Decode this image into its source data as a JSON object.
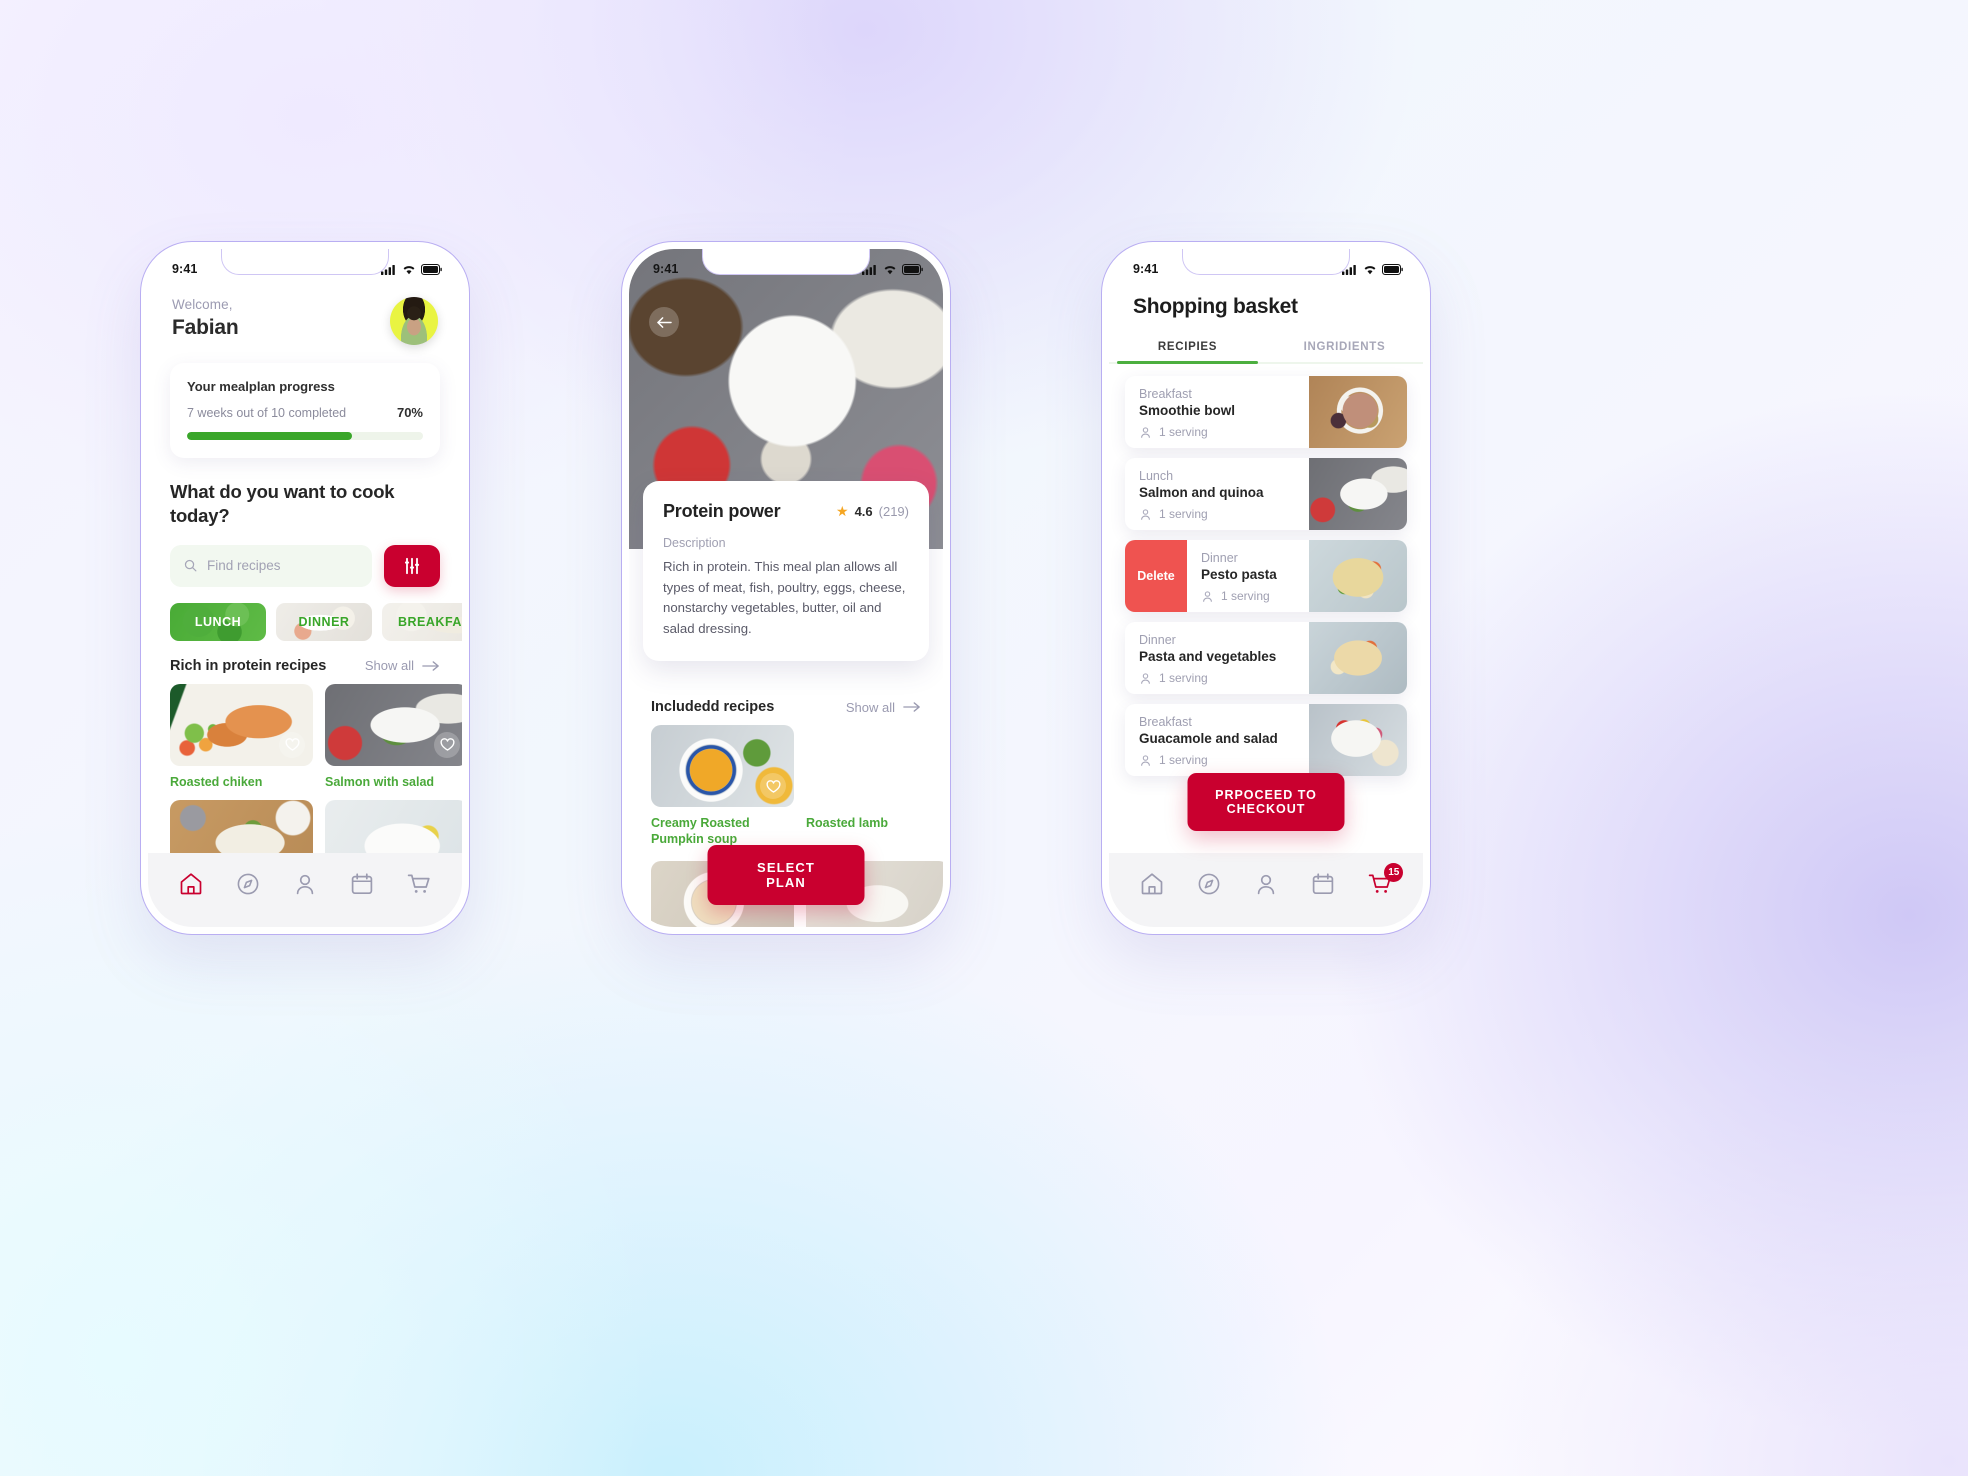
{
  "status_bar": {
    "time": "9:41",
    "signal_icon": "cellular-signal-icon",
    "wifi_icon": "wifi-icon",
    "battery_icon": "battery-icon"
  },
  "colors": {
    "brand_red": "#C9002F",
    "green": "#4CAF3F",
    "delete_red": "#EF5350",
    "star_orange": "#F5A623",
    "muted": "#9F9FB1"
  },
  "phone1": {
    "welcome_label": "Welcome,",
    "user_name": "Fabian",
    "avatar_name": "user-avatar",
    "progress": {
      "title": "Your mealplan progress",
      "subtitle": "7 weeks out of 10 completed",
      "percent_label": "70%",
      "percent_value": 70
    },
    "question": "What do you want to cook today?",
    "search": {
      "placeholder": "Find recipes",
      "value": "",
      "icon": "search-icon"
    },
    "filter_button": {
      "icon": "sliders-filter-icon"
    },
    "chips": [
      {
        "label": "LUNCH",
        "active": true
      },
      {
        "label": "DINNER",
        "active": false
      },
      {
        "label": "BREAKFAST",
        "active": false
      }
    ],
    "section": {
      "title": "Rich in protein recipes",
      "show_all": "Show all"
    },
    "recipes": [
      {
        "name": "Roasted chiken"
      },
      {
        "name": "Salmon with salad"
      }
    ],
    "tabbar": [
      {
        "name": "home",
        "icon": "home-icon",
        "active": true
      },
      {
        "name": "explore",
        "icon": "compass-icon",
        "active": false
      },
      {
        "name": "profile",
        "icon": "person-icon",
        "active": false
      },
      {
        "name": "planner",
        "icon": "calendar-icon",
        "active": false
      },
      {
        "name": "cart",
        "icon": "cart-icon",
        "active": false
      }
    ]
  },
  "phone2": {
    "back_button": {
      "icon": "arrow-left-icon"
    },
    "plan": {
      "title": "Protein power",
      "rating_value": "4.6",
      "rating_count": "(219)",
      "star_icon": "star-icon",
      "description_label": "Description",
      "description": "Rich in protein. This meal plan allows all types of meat, fish, poultry, eggs, cheese, nonstarchy vegetables, butter, oil and salad dressing."
    },
    "section": {
      "title": "Includedd recipes",
      "show_all": "Show all"
    },
    "recipes": [
      {
        "name": "Creamy Roasted Pumpkin soup"
      },
      {
        "name": "Roasted lamb"
      }
    ],
    "select_plan_label": "SELECT PLAN"
  },
  "phone3": {
    "title": "Shopping basket",
    "tabs": [
      {
        "label": "RECIPIES",
        "active": true
      },
      {
        "label": "INGRIDIENTS",
        "active": false
      }
    ],
    "items": [
      {
        "meal": "Breakfast",
        "name": "Smoothie bowl",
        "servings": "1 serving",
        "swiped": false
      },
      {
        "meal": "Lunch",
        "name": "Salmon and quinoa",
        "servings": "1 serving",
        "swiped": false
      },
      {
        "meal": "Dinner",
        "name": "Pesto pasta",
        "servings": "1 serving",
        "swiped": true,
        "delete_label": "Delete"
      },
      {
        "meal": "Dinner",
        "name": "Pasta and vegetables",
        "servings": "1 serving",
        "swiped": false
      },
      {
        "meal": "Breakfast",
        "name": "Guacamole and salad",
        "servings": "1 serving",
        "swiped": false
      }
    ],
    "checkout_label": "PRPOCEED TO CHECKOUT",
    "cart_badge": "15",
    "tabbar": [
      {
        "name": "home",
        "icon": "home-icon",
        "active": false
      },
      {
        "name": "explore",
        "icon": "compass-icon",
        "active": false
      },
      {
        "name": "profile",
        "icon": "person-icon",
        "active": false
      },
      {
        "name": "planner",
        "icon": "calendar-icon",
        "active": false
      },
      {
        "name": "cart",
        "icon": "cart-icon",
        "active": true
      }
    ]
  }
}
